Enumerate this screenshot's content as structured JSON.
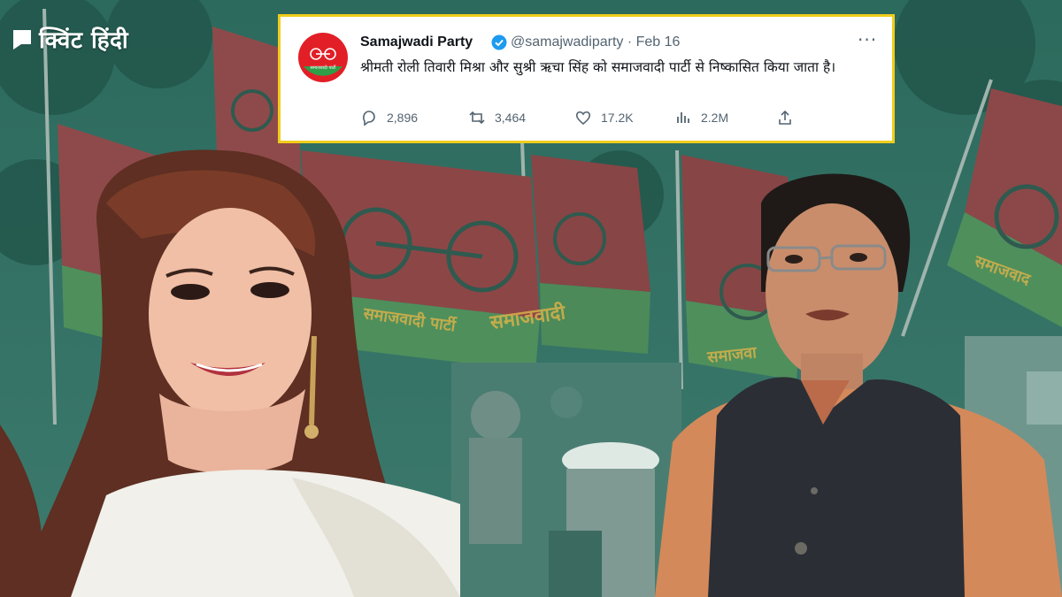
{
  "brand": {
    "name": "क्विंट हिंदी"
  },
  "tweet": {
    "account_name": "Samajwadi Party",
    "handle": "@samajwadiparty",
    "date": "Feb 16",
    "handle_date": "@samajwadiparty · Feb 16",
    "text": "श्रीमती रोली तिवारी मिश्रा और सुश्री ऋचा सिंह को समाजवादी पार्टी से निष्कासित किया जाता है।",
    "avatar_text": "समाजवादी पार्टी",
    "stats": {
      "replies": "2,896",
      "retweets": "3,464",
      "likes": "17.2K",
      "views": "2.2M"
    }
  },
  "banners": {
    "flag_text": "समाजवादी"
  },
  "colors": {
    "frame": "#f1cd1b",
    "party_red": "#c8232c",
    "party_green": "#2e9e48",
    "verified": "#1d9bf0",
    "tint": "#2f6e62"
  },
  "icons": [
    "reply-icon",
    "retweet-icon",
    "like-icon",
    "views-icon",
    "share-icon",
    "more-icon",
    "verified-icon"
  ]
}
